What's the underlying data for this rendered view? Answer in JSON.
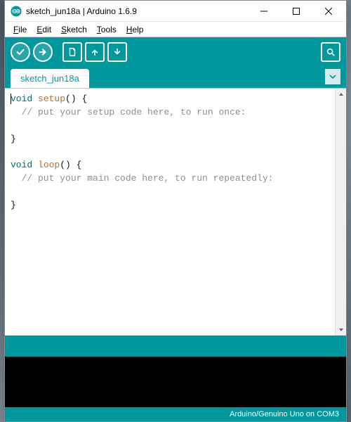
{
  "window": {
    "title": "sketch_jun18a | Arduino 1.6.9"
  },
  "menu": {
    "items": [
      {
        "label": "File",
        "accel": "F"
      },
      {
        "label": "Edit",
        "accel": "E"
      },
      {
        "label": "Sketch",
        "accel": "S"
      },
      {
        "label": "Tools",
        "accel": "T"
      },
      {
        "label": "Help",
        "accel": "H"
      }
    ]
  },
  "toolbar": {
    "verify": "verify",
    "upload": "upload",
    "new": "new",
    "open": "open",
    "save": "save",
    "serial": "serial-monitor"
  },
  "tabs": {
    "active": "sketch_jun18a"
  },
  "code": {
    "l1_kw": "void",
    "l1_fn": "setup",
    "l1_rest": "() {",
    "l2_com": "  // put your setup code here, to run once:",
    "l3": "",
    "l4": "}",
    "l5": "",
    "l6_kw": "void",
    "l6_fn": "loop",
    "l6_rest": "() {",
    "l7_com": "  // put your main code here, to run repeatedly:",
    "l8": "",
    "l9": "}"
  },
  "footer": {
    "board": "Arduino/Genuino Uno on COM3"
  },
  "colors": {
    "accent": "#00979d"
  }
}
